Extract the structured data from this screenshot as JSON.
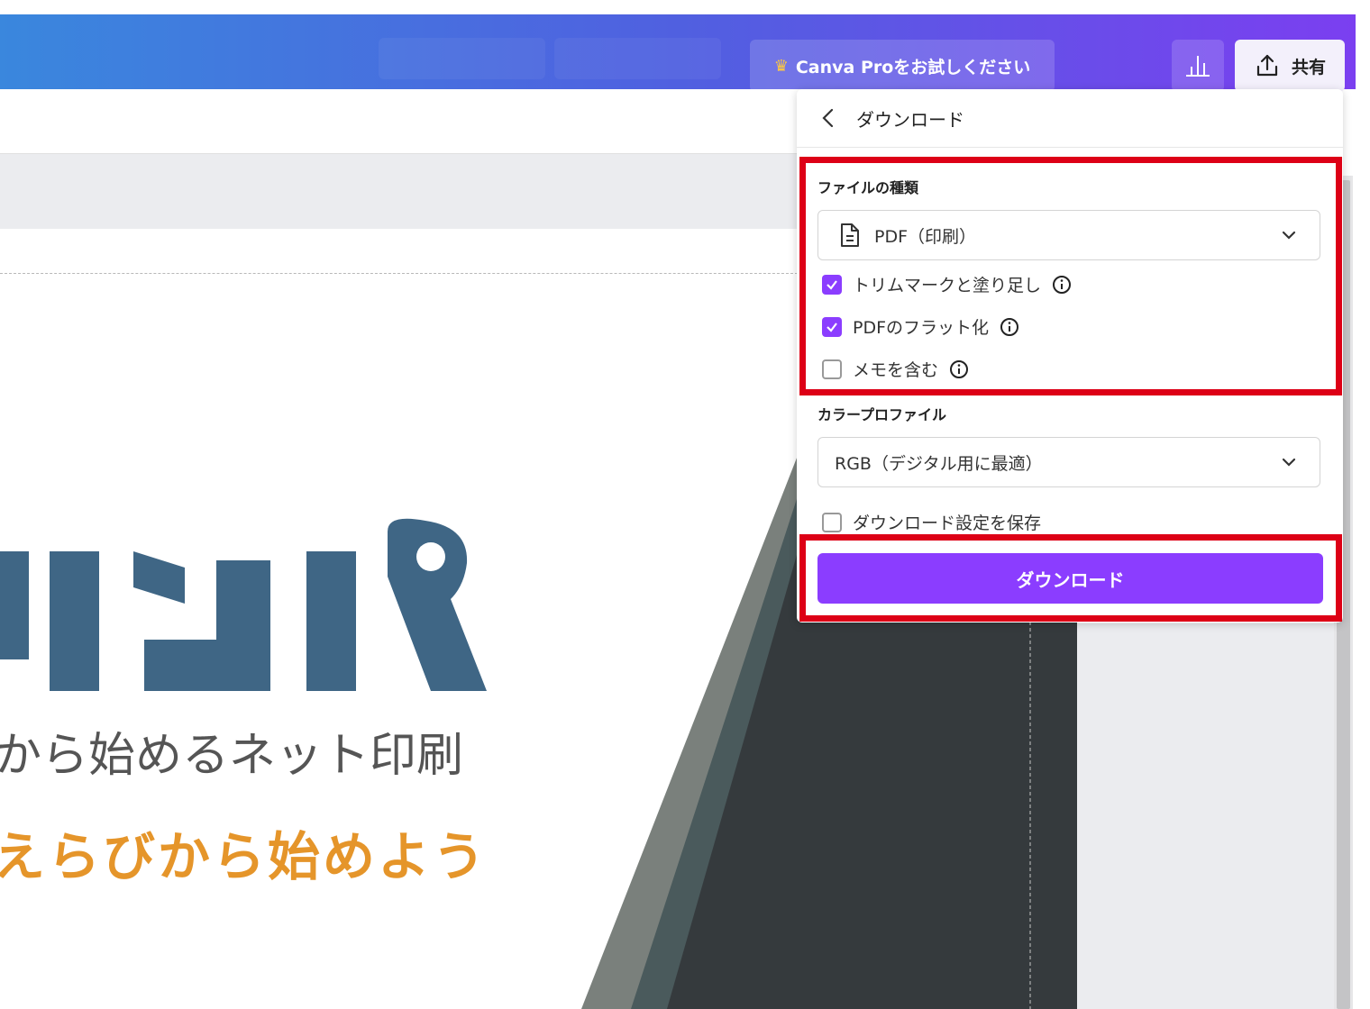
{
  "topbar": {
    "pro_label": "Canva Proをお試しください",
    "share_label": "共有"
  },
  "canvas": {
    "subtitle": "から始めるネット印刷",
    "slogan": "えらびから始めよう"
  },
  "panel": {
    "title": "ダウンロード",
    "file_type_label": "ファイルの種類",
    "file_type_value": "PDF（印刷）",
    "options": [
      {
        "label": "トリムマークと塗り足し",
        "checked": true
      },
      {
        "label": "PDFのフラット化",
        "checked": true
      },
      {
        "label": "メモを含む",
        "checked": false
      }
    ],
    "color_profile_label": "カラープロファイル",
    "color_profile_value": "RGB（デジタル用に最適）",
    "save_settings_label": "ダウンロード設定を保存",
    "save_settings_checked": false,
    "download_button": "ダウンロード"
  },
  "colors": {
    "accent": "#8b3dff",
    "highlight": "#dd0016",
    "logo": "#3f6685",
    "slogan": "#e5952a"
  }
}
